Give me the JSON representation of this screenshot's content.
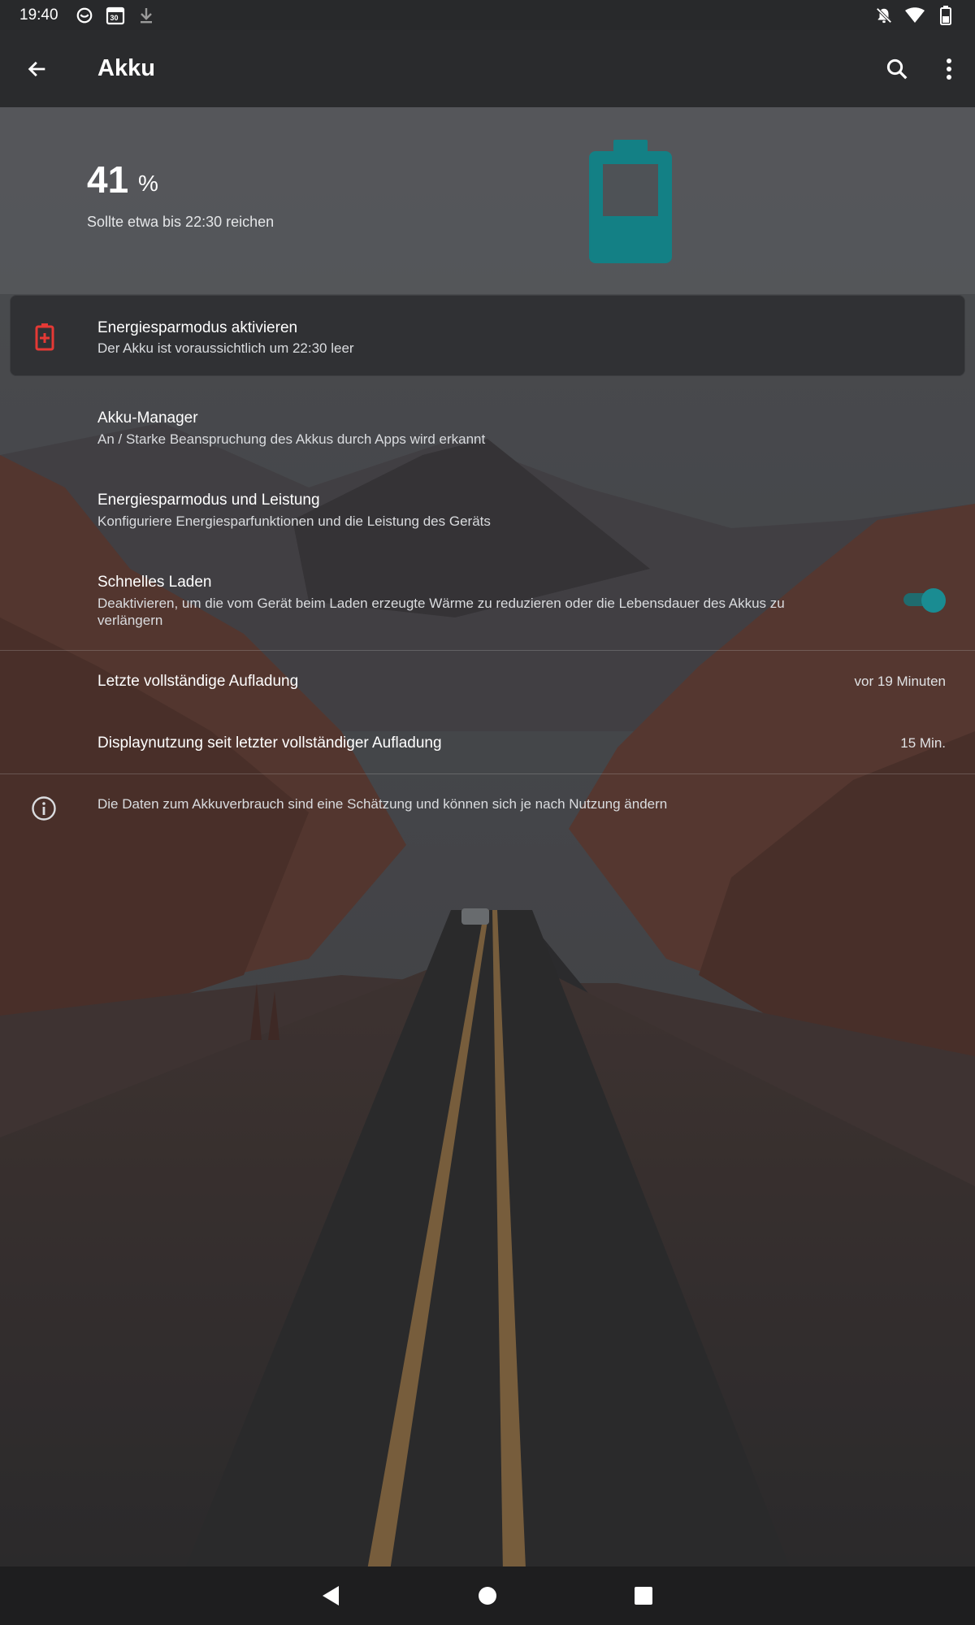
{
  "status_bar": {
    "time": "19:40",
    "left_icons": [
      "moon-crescent-icon",
      "calendar-icon",
      "download-icon"
    ],
    "calendar_day": "30",
    "right_icons": [
      "notifications-off-icon",
      "wifi-icon",
      "battery-icon"
    ]
  },
  "app_bar": {
    "title": "Akku",
    "icons": [
      "back-arrow-icon",
      "search-icon",
      "more-vert-icon"
    ]
  },
  "header": {
    "percent": "41",
    "percent_unit": "%",
    "estimate": "Sollte etwa bis 22:30 reichen",
    "battery_level": 0.41,
    "accent_color": "#138085"
  },
  "saver_card": {
    "title": "Energiesparmodus aktivieren",
    "subtitle": "Der Akku ist voraussichtlich um 22:30 leer",
    "icon": "battery-plus-icon",
    "icon_color": "#e53935"
  },
  "rows": {
    "battery_manager": {
      "title": "Akku-Manager",
      "subtitle": "An / Starke Beanspruchung des Akkus durch Apps wird erkannt"
    },
    "power_saving": {
      "title": "Energiesparmodus und Leistung",
      "subtitle": "Konfiguriere Energiesparfunktionen und die Leistung des Geräts"
    },
    "fast_charging": {
      "title": "Schnelles Laden",
      "subtitle": "Deaktivieren, um die vom Gerät beim Laden erzeugte Wärme zu reduzieren oder die Lebensdauer des Akkus zu verlängern",
      "enabled": true
    },
    "last_full_charge": {
      "title": "Letzte vollständige Aufladung",
      "value": "vor 19 Minuten"
    },
    "screen_usage": {
      "title": "Displaynutzung seit letzter vollständiger Aufladung",
      "value": "15 Min."
    }
  },
  "info": {
    "icon": "info-icon",
    "text": "Die Daten zum Akkuverbrauch sind eine Schätzung und können sich je nach Nutzung ändern"
  },
  "nav_bar": {
    "icons": [
      "nav-back-icon",
      "nav-home-icon",
      "nav-recents-icon"
    ]
  }
}
